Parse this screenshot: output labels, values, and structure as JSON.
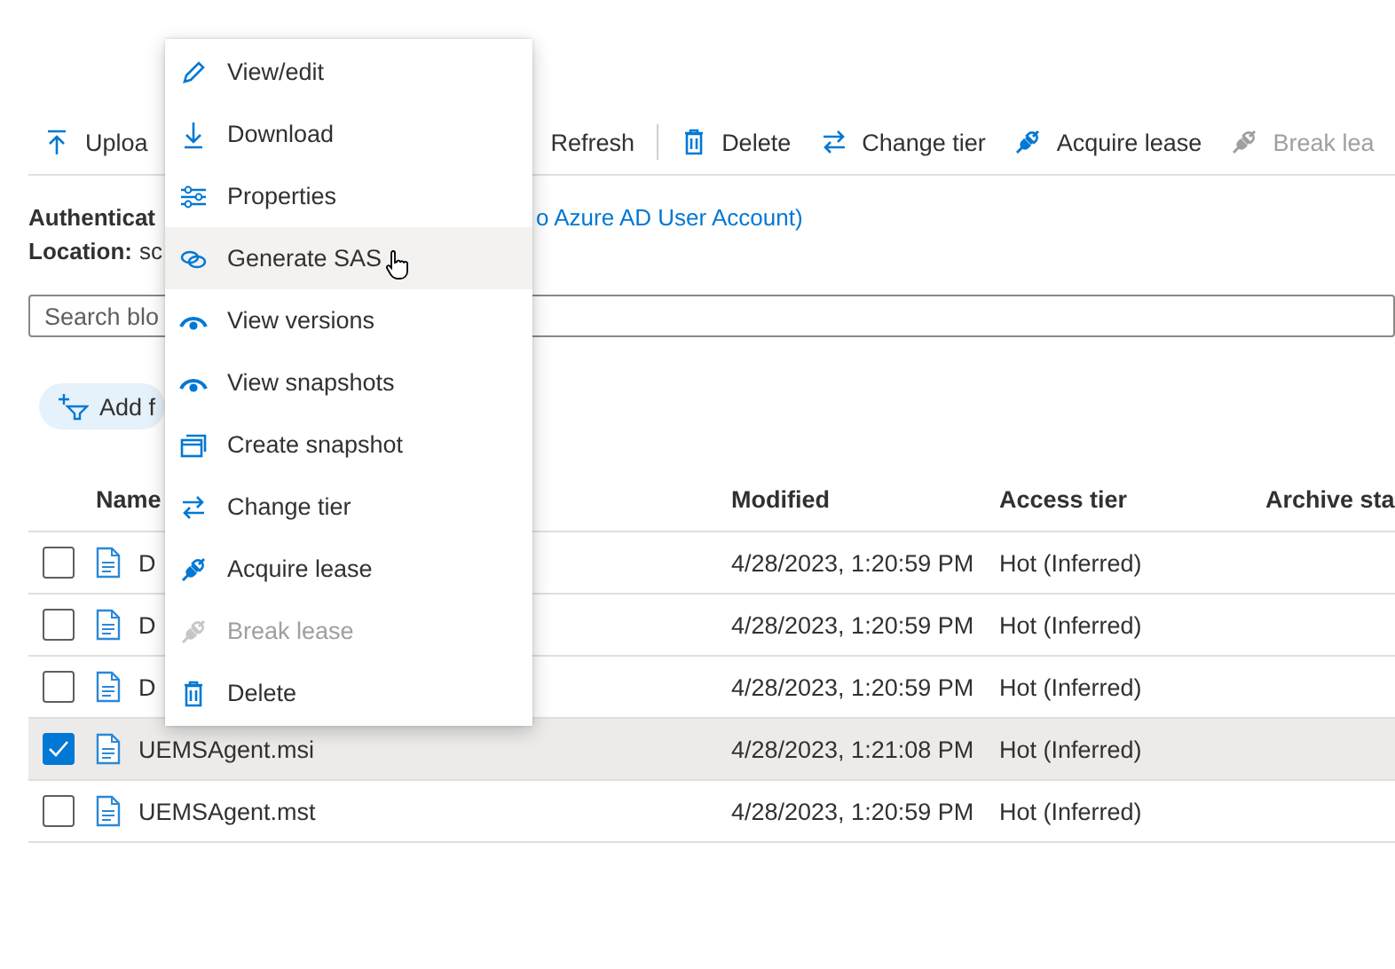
{
  "toolbar": [
    {
      "label": "Uploa",
      "kind": "upload",
      "disabled": false
    },
    {
      "label": "Refresh",
      "disabled": false
    },
    {
      "label": "Delete",
      "kind": "trash",
      "disabled": false
    },
    {
      "label": "Change tier",
      "kind": "swap",
      "disabled": false
    },
    {
      "label": "Acquire lease",
      "kind": "plug",
      "disabled": false
    },
    {
      "label": "Break lea",
      "kind": "plug",
      "disabled": true
    }
  ],
  "info": {
    "auth_label": "Authenticat",
    "auth_link": "o Azure AD User Account)",
    "location_label": "Location:",
    "location_value": "sc"
  },
  "search": {
    "placeholder": "Search blo"
  },
  "filter_button": "Add f",
  "table": {
    "columns": [
      "Name",
      "Modified",
      "Access tier",
      "Archive sta"
    ],
    "rows": [
      {
        "name": "D",
        "modified": "4/28/2023, 1:20:59 PM",
        "tier": "Hot (Inferred)",
        "selected": false
      },
      {
        "name": "D",
        "modified": "4/28/2023, 1:20:59 PM",
        "tier": "Hot (Inferred)",
        "selected": false
      },
      {
        "name": "D",
        "modified": "4/28/2023, 1:20:59 PM",
        "tier": "Hot (Inferred)",
        "selected": false
      },
      {
        "name": "UEMSAgent.msi",
        "modified": "4/28/2023, 1:21:08 PM",
        "tier": "Hot (Inferred)",
        "selected": true
      },
      {
        "name": "UEMSAgent.mst",
        "modified": "4/28/2023, 1:20:59 PM",
        "tier": "Hot (Inferred)",
        "selected": false
      }
    ]
  },
  "context_menu": [
    {
      "label": "View/edit",
      "kind": "pencil",
      "disabled": false,
      "selected": false
    },
    {
      "label": "Download",
      "kind": "download",
      "disabled": false,
      "selected": false
    },
    {
      "label": "Properties",
      "kind": "sliders",
      "disabled": false,
      "selected": false
    },
    {
      "label": "Generate SAS",
      "kind": "link",
      "disabled": false,
      "selected": true
    },
    {
      "label": "View versions",
      "kind": "eye",
      "disabled": false,
      "selected": false
    },
    {
      "label": "View snapshots",
      "kind": "eye",
      "disabled": false,
      "selected": false
    },
    {
      "label": "Create snapshot",
      "kind": "windows",
      "disabled": false,
      "selected": false
    },
    {
      "label": "Change tier",
      "kind": "swap",
      "disabled": false,
      "selected": false
    },
    {
      "label": "Acquire lease",
      "kind": "plug",
      "disabled": false,
      "selected": false
    },
    {
      "label": "Break lease",
      "kind": "plug",
      "disabled": true,
      "selected": false
    },
    {
      "label": "Delete",
      "kind": "trash",
      "disabled": false,
      "selected": false
    }
  ]
}
